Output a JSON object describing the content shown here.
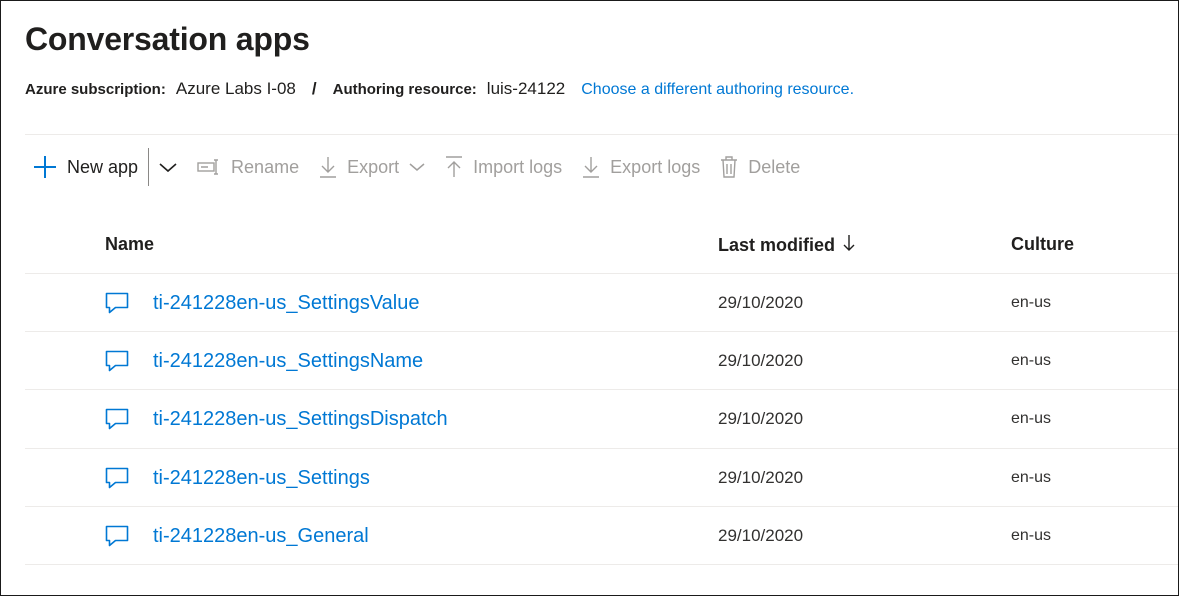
{
  "page": {
    "title": "Conversation apps"
  },
  "subscription": {
    "label": "Azure subscription:",
    "value": "Azure Labs I-08",
    "separator": "/",
    "resource_label": "Authoring resource:",
    "resource_value": "luis-24122",
    "change_link": "Choose a different authoring resource."
  },
  "toolbar": {
    "new_app": "New app",
    "rename": "Rename",
    "export": "Export",
    "import_logs": "Import logs",
    "export_logs": "Export logs",
    "delete": "Delete"
  },
  "table": {
    "columns": {
      "name": "Name",
      "last_modified": "Last modified",
      "culture": "Culture"
    },
    "rows": [
      {
        "name": "ti-241228en-us_SettingsValue",
        "last_modified": "29/10/2020",
        "culture": "en-us"
      },
      {
        "name": "ti-241228en-us_SettingsName",
        "last_modified": "29/10/2020",
        "culture": "en-us"
      },
      {
        "name": "ti-241228en-us_SettingsDispatch",
        "last_modified": "29/10/2020",
        "culture": "en-us"
      },
      {
        "name": "ti-241228en-us_Settings",
        "last_modified": "29/10/2020",
        "culture": "en-us"
      },
      {
        "name": "ti-241228en-us_General",
        "last_modified": "29/10/2020",
        "culture": "en-us"
      }
    ]
  },
  "icons": {
    "new_app": "add-icon",
    "new_app_menu": "chevron-down-icon",
    "rename": "rename-icon",
    "export": "download-icon",
    "export_menu": "chevron-down-icon",
    "import_logs": "upload-icon",
    "export_logs": "download-icon",
    "delete": "trash-icon",
    "sort": "arrow-down-icon",
    "row": "chat-bubble-icon"
  },
  "colors": {
    "accent": "#0078d4",
    "disabled": "#a19f9d",
    "text": "#201f1e",
    "divider": "#edebe9"
  }
}
